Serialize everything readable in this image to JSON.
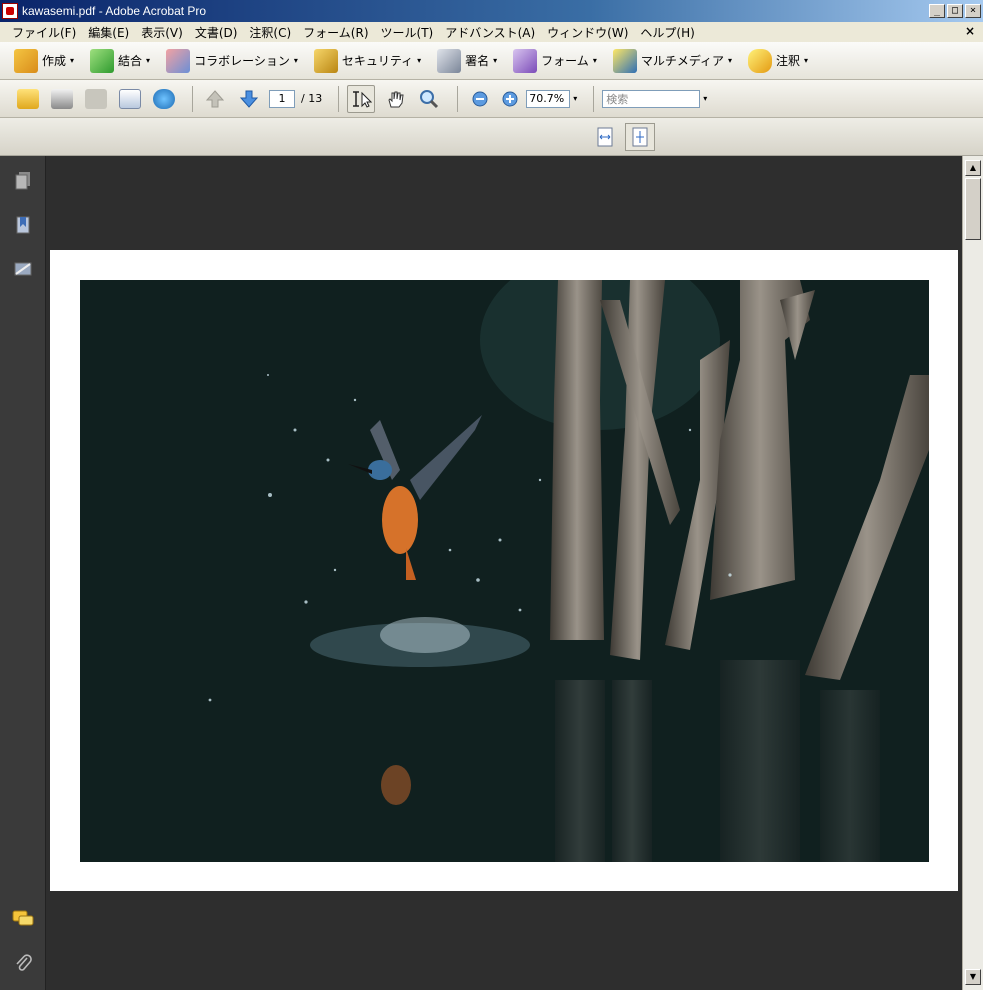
{
  "window": {
    "title": "kawasemi.pdf - Adobe Acrobat Pro",
    "min_glyph": "_",
    "max_glyph": "□",
    "close_glyph": "×"
  },
  "menu": {
    "items": [
      "ファイル(F)",
      "編集(E)",
      "表示(V)",
      "文書(D)",
      "注釈(C)",
      "フォーム(R)",
      "ツール(T)",
      "アドバンスト(A)",
      "ウィンドウ(W)",
      "ヘルプ(H)"
    ],
    "close_glyph": "×"
  },
  "tasks": {
    "create": "作成",
    "combine": "結合",
    "collaborate": "コラボレーション",
    "security": "セキュリティ",
    "sign": "署名",
    "forms": "フォーム",
    "multimedia": "マルチメディア",
    "comment": "注釈",
    "caret": "▾"
  },
  "nav": {
    "current_page": "1",
    "total_pages": "/ 13",
    "zoom": "70.7%",
    "search_placeholder": "検索",
    "caret": "▾"
  },
  "scroll": {
    "up": "▲",
    "down": "▼"
  },
  "colors": {
    "accent": "#0a246a",
    "doc_background": "#2e2e2e",
    "sidebar": "#3a3a3a"
  }
}
